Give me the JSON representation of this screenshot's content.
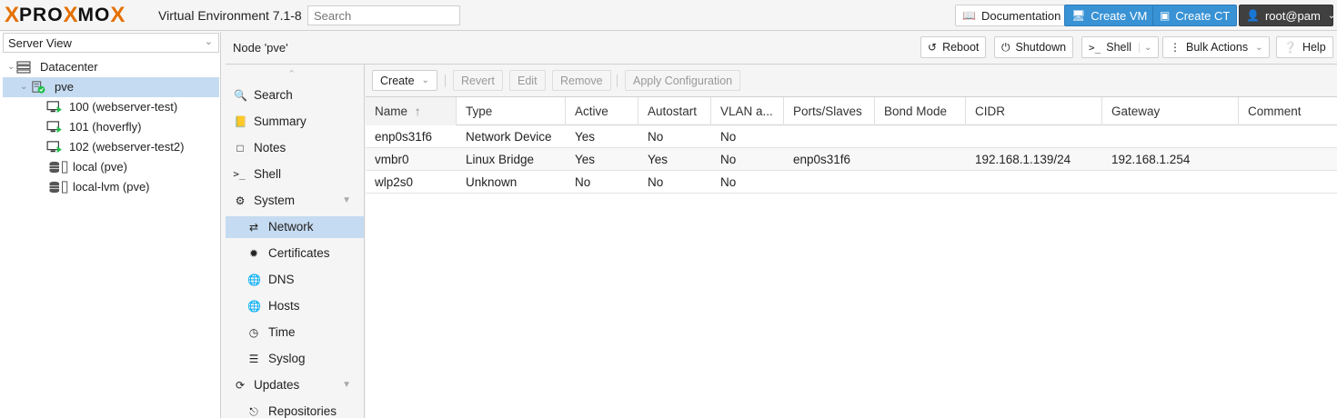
{
  "topbar": {
    "logo_x": "X",
    "logo_pro": "PRO",
    "logo_x2": "X",
    "logo_mo": "MO",
    "logo_x3": "X",
    "version": "Virtual Environment 7.1-8",
    "search_placeholder": "Search",
    "documentation": "Documentation",
    "create_vm": "Create VM",
    "create_ct": "Create CT",
    "user": "root@pam"
  },
  "left": {
    "view": "Server View",
    "tree": [
      {
        "label": "Datacenter",
        "icon": "datacenter-icon"
      },
      {
        "label": "pve",
        "icon": "node-online-icon",
        "selected": true
      },
      {
        "label": "100 (webserver-test)",
        "icon": "vm-running-icon"
      },
      {
        "label": "101 (hoverfly)",
        "icon": "vm-running-icon"
      },
      {
        "label": "102 (webserver-test2)",
        "icon": "vm-running-icon"
      },
      {
        "label": "local (pve)",
        "icon": "storage-icon"
      },
      {
        "label": "local-lvm (pve)",
        "icon": "storage-icon"
      }
    ]
  },
  "header": {
    "title": "Node 'pve'",
    "reboot": "Reboot",
    "shutdown": "Shutdown",
    "shell": "Shell",
    "bulk_actions": "Bulk Actions",
    "help": "Help"
  },
  "nav": [
    {
      "label": "Search",
      "icon": "search-icon"
    },
    {
      "label": "Summary",
      "icon": "summary-icon"
    },
    {
      "label": "Notes",
      "icon": "notes-icon"
    },
    {
      "label": "Shell",
      "icon": "terminal-icon"
    },
    {
      "label": "System",
      "icon": "gears-icon"
    },
    {
      "label": "Network",
      "icon": "network-icon",
      "selected": true
    },
    {
      "label": "Certificates",
      "icon": "certificate-icon"
    },
    {
      "label": "DNS",
      "icon": "globe-icon"
    },
    {
      "label": "Hosts",
      "icon": "globe-icon"
    },
    {
      "label": "Time",
      "icon": "clock-icon"
    },
    {
      "label": "Syslog",
      "icon": "list-icon"
    },
    {
      "label": "Updates",
      "icon": "refresh-icon"
    },
    {
      "label": "Repositories",
      "icon": "repository-icon"
    }
  ],
  "toolbar": {
    "create": "Create",
    "revert": "Revert",
    "edit": "Edit",
    "remove": "Remove",
    "apply": "Apply Configuration"
  },
  "table": {
    "columns": [
      "Name",
      "Type",
      "Active",
      "Autostart",
      "VLAN a...",
      "Ports/Slaves",
      "Bond Mode",
      "CIDR",
      "Gateway",
      "Comment"
    ],
    "rows": [
      [
        "enp0s31f6",
        "Network Device",
        "Yes",
        "No",
        "No",
        "",
        "",
        "",
        "",
        ""
      ],
      [
        "vmbr0",
        "Linux Bridge",
        "Yes",
        "Yes",
        "No",
        "enp0s31f6",
        "",
        "192.168.1.139/24",
        "192.168.1.254",
        ""
      ],
      [
        "wlp2s0",
        "Unknown",
        "No",
        "No",
        "No",
        "",
        "",
        "",
        "",
        ""
      ]
    ]
  },
  "colors": {
    "accent_orange": "#e57000",
    "button_blue": "#3892d4",
    "selection": "#c5dbf1"
  }
}
